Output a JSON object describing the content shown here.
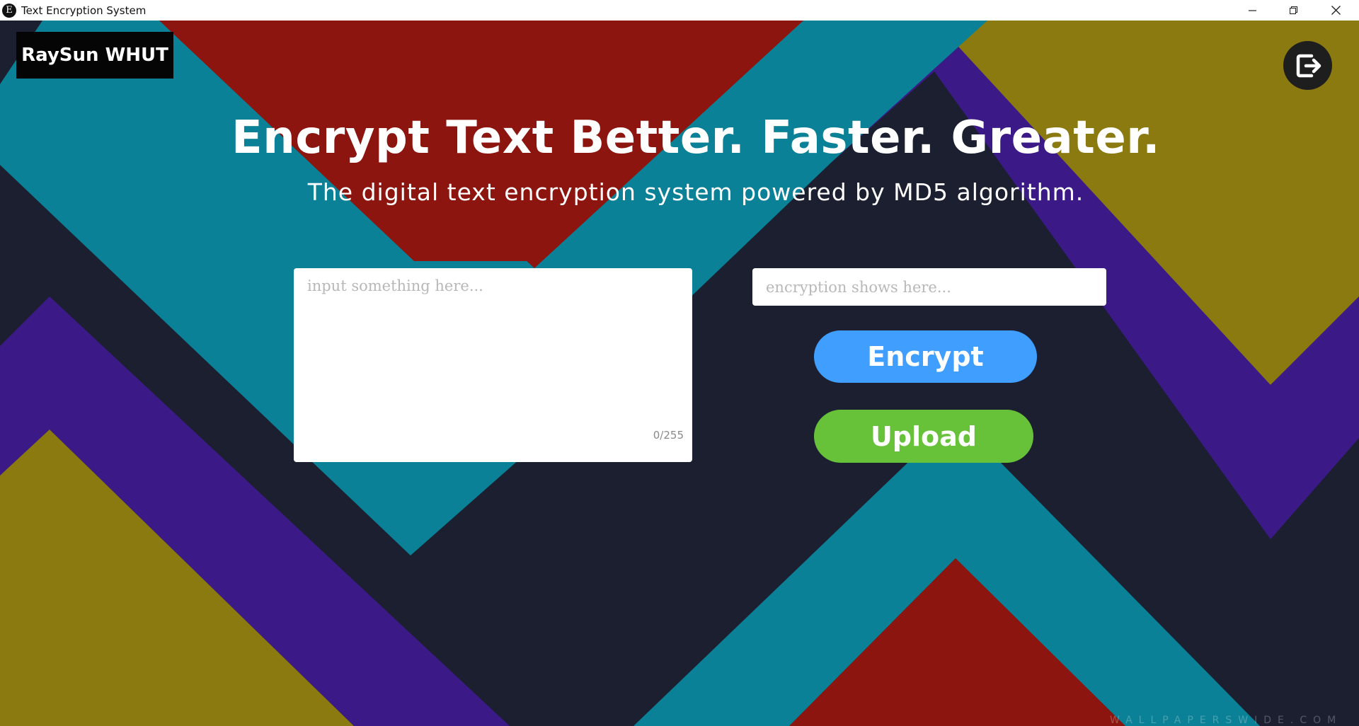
{
  "window": {
    "title": "Text Encryption System",
    "icon_glyph": "E",
    "controls": {
      "minimize_icon": "minimize-icon",
      "maximize_icon": "restore-icon",
      "close_icon": "close-icon"
    }
  },
  "header": {
    "brand": "RaySun WHUT",
    "logout_icon": "logout-icon"
  },
  "hero": {
    "title": "Encrypt Text Better. Faster. Greater.",
    "subtitle": "The digital text encryption system powered by MD5 algorithm."
  },
  "form": {
    "input": {
      "value": "",
      "placeholder": "input something here...",
      "counter": "0/255"
    },
    "output": {
      "value": "",
      "placeholder": "encryption shows here..."
    },
    "encrypt_label": "Encrypt",
    "upload_label": "Upload"
  },
  "background": {
    "watermark": "WALLPAPERSWIDE.COM"
  },
  "colors": {
    "encrypt": "#409eff",
    "upload": "#67c23a",
    "bg_dark": "#1b1f30",
    "red": "#8c160f",
    "teal": "#0a8196",
    "purple": "#3b1a88",
    "olive": "#8a7a10"
  }
}
